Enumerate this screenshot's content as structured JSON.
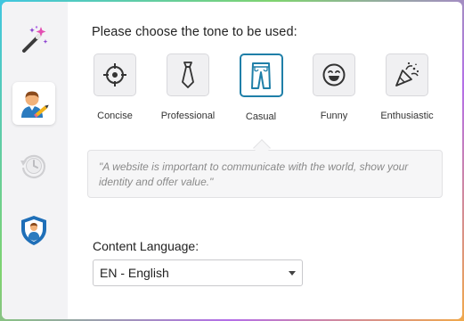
{
  "sidebar": {
    "items": [
      {
        "name": "magic-wand",
        "icon": "magic-wand-icon"
      },
      {
        "name": "user-writer",
        "icon": "user-edit-icon",
        "active": true
      },
      {
        "name": "history",
        "icon": "history-clock-icon"
      },
      {
        "name": "security",
        "icon": "shield-user-icon"
      }
    ]
  },
  "main": {
    "prompt": "Please choose the tone to be used:",
    "tones": [
      {
        "label": "Concise",
        "icon": "target-icon"
      },
      {
        "label": "Professional",
        "icon": "tie-icon"
      },
      {
        "label": "Casual",
        "icon": "jeans-icon",
        "selected": true
      },
      {
        "label": "Funny",
        "icon": "laugh-icon"
      },
      {
        "label": "Enthusiastic",
        "icon": "party-popper-icon"
      }
    ],
    "example_text": "\"A website is important to communicate with the world, show your identity and offer value.\"",
    "language_label": "Content Language:",
    "language_value": "EN - English"
  },
  "colors": {
    "accent": "#1f7fa8",
    "sidebar_bg": "#f3f3f5",
    "icon_blue": "#2b7bbf",
    "wand_purple": "#8a3fd1"
  }
}
